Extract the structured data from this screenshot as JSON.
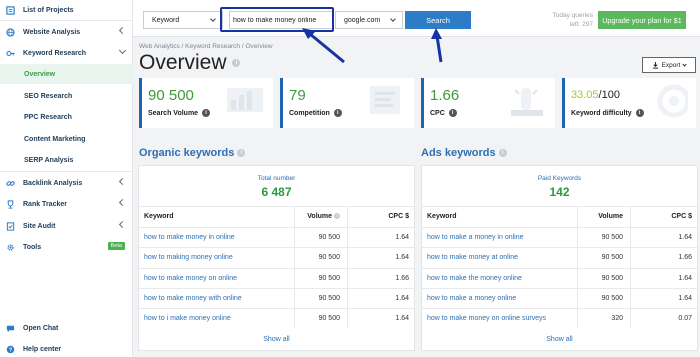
{
  "sidebar": {
    "items": [
      {
        "label": "List of Projects",
        "icon": "folder-icon"
      },
      {
        "label": "Website Analysis",
        "icon": "globe-icon"
      },
      {
        "label": "Keyword Research",
        "icon": "key-icon"
      },
      {
        "label": "Backlink Analysis",
        "icon": "link-icon"
      },
      {
        "label": "Rank Tracker",
        "icon": "trophy-icon"
      },
      {
        "label": "Site Audit",
        "icon": "audit-icon"
      },
      {
        "label": "Tools",
        "icon": "gear-icon",
        "badge": "Beta"
      }
    ],
    "subitems": [
      "Overview",
      "SEO Research",
      "PPC Research",
      "Content Marketing",
      "SERP Analysis"
    ],
    "bottom": [
      {
        "label": "Open Chat",
        "icon": "chat-icon"
      },
      {
        "label": "Help center",
        "icon": "help-icon"
      }
    ]
  },
  "topbar": {
    "mode_select": "Keyword",
    "query": "how to make money online",
    "engine_select": "google.com",
    "search_label": "Search",
    "quota_line1": "Today queries",
    "quota_line2": "left: 297",
    "upgrade_label": "Upgrade your plan for $1"
  },
  "breadcrumb": "Web Analytics / Keyword Research / Overview",
  "page_title": "Overview",
  "export_label": "Export",
  "cards": [
    {
      "value": "90 500",
      "label": "Search Volume",
      "color": "#3d9a3b"
    },
    {
      "value": "79",
      "label": "Competition",
      "color": "#3d9a3b"
    },
    {
      "value": "1.66",
      "label": "CPC",
      "color": "#3d9a3b"
    },
    {
      "value_main": "33.05",
      "value_rest": "/100",
      "label": "Keyword difficulty",
      "color": "#9acb3a"
    }
  ],
  "organic": {
    "title": "Organic keywords",
    "total_label": "Total number",
    "total_value": "6 487",
    "columns": [
      "Keyword",
      "Volume",
      "CPC $"
    ],
    "rows": [
      {
        "kw": "how to make money in online",
        "vol": "90 500",
        "cpc": "1.64"
      },
      {
        "kw": "how to making money online",
        "vol": "90 500",
        "cpc": "1.64"
      },
      {
        "kw": "how to make money on online",
        "vol": "90 500",
        "cpc": "1.66"
      },
      {
        "kw": "how to make money with online",
        "vol": "90 500",
        "cpc": "1.64"
      },
      {
        "kw": "how to i make money online",
        "vol": "90 500",
        "cpc": "1.64"
      }
    ],
    "show_all": "Show all"
  },
  "ads": {
    "title": "Ads keywords",
    "total_label": "Paid Keywords",
    "total_value": "142",
    "columns": [
      "Keyword",
      "Volume",
      "CPC $"
    ],
    "rows": [
      {
        "kw": "how to make a money in online",
        "vol": "90 500",
        "cpc": "1.64"
      },
      {
        "kw": "how to make money at online",
        "vol": "90 500",
        "cpc": "1.66"
      },
      {
        "kw": "how to make the money online",
        "vol": "90 500",
        "cpc": "1.64"
      },
      {
        "kw": "how to make a money online",
        "vol": "90 500",
        "cpc": "1.64"
      },
      {
        "kw": "how to make money on online surveys",
        "vol": "320",
        "cpc": "0.07"
      }
    ],
    "show_all": "Show all"
  },
  "colors": {
    "accent_blue": "#2d7cc8",
    "green": "#5cb85c",
    "annotation": "#1633a6"
  }
}
